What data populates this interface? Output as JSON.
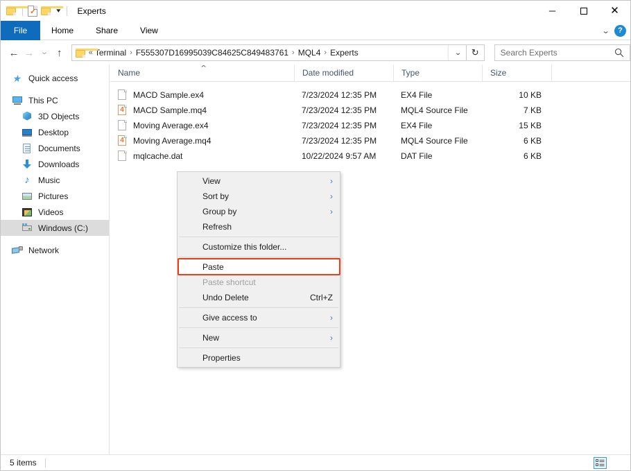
{
  "window": {
    "title": "Experts",
    "quick_access": {
      "folder_icon": "folder-icon",
      "properties_icon": "properties-document-icon",
      "new_folder_icon": "new-folder-icon",
      "customize_caret": "▾"
    },
    "controls": {
      "minimize": "─",
      "maximize": "maximize-icon",
      "close": "✕"
    }
  },
  "ribbon": {
    "tabs": [
      {
        "label": "File"
      },
      {
        "label": "Home"
      },
      {
        "label": "Share"
      },
      {
        "label": "View"
      }
    ],
    "collapse_caret": "⌄",
    "help_label": "?"
  },
  "address": {
    "back_icon": "←",
    "forward_icon": "→",
    "recent_icon": "⌄",
    "up_icon": "↑",
    "root_chevrons": "«",
    "crumbs": [
      "Terminal",
      "F555307D16995039C84625C849483761",
      "MQL4",
      "Experts"
    ],
    "crumb_separator": "›",
    "dropdown_caret": "⌄",
    "refresh_icon": "↻"
  },
  "search": {
    "placeholder": "Search Experts",
    "icon": "search-icon"
  },
  "sidebar": {
    "items": [
      {
        "label": "Quick access",
        "icon": "star-icon",
        "indent": false,
        "selected": false,
        "gap_after": true
      },
      {
        "label": "This PC",
        "icon": "computer-icon",
        "indent": false,
        "selected": false,
        "gap_after": false
      },
      {
        "label": "3D Objects",
        "icon": "3d-objects-icon",
        "indent": true,
        "selected": false,
        "gap_after": false
      },
      {
        "label": "Desktop",
        "icon": "desktop-icon",
        "indent": true,
        "selected": false,
        "gap_after": false
      },
      {
        "label": "Documents",
        "icon": "documents-icon",
        "indent": true,
        "selected": false,
        "gap_after": false
      },
      {
        "label": "Downloads",
        "icon": "downloads-icon",
        "indent": true,
        "selected": false,
        "gap_after": false
      },
      {
        "label": "Music",
        "icon": "music-icon",
        "indent": true,
        "selected": false,
        "gap_after": false
      },
      {
        "label": "Pictures",
        "icon": "pictures-icon",
        "indent": true,
        "selected": false,
        "gap_after": false
      },
      {
        "label": "Videos",
        "icon": "videos-icon",
        "indent": true,
        "selected": false,
        "gap_after": false
      },
      {
        "label": "Windows (C:)",
        "icon": "drive-icon",
        "indent": true,
        "selected": true,
        "gap_after": true
      },
      {
        "label": "Network",
        "icon": "network-icon",
        "indent": false,
        "selected": false,
        "gap_after": false
      }
    ]
  },
  "filelist": {
    "columns": [
      {
        "key": "name",
        "label": "Name"
      },
      {
        "key": "date",
        "label": "Date modified"
      },
      {
        "key": "type",
        "label": "Type"
      },
      {
        "key": "size",
        "label": "Size"
      }
    ],
    "sort_indicator": "⌃",
    "rows": [
      {
        "name": "MACD Sample.ex4",
        "date": "7/23/2024 12:35 PM",
        "type": "EX4 File",
        "size": "10 KB",
        "icon": "generic-file-icon"
      },
      {
        "name": "MACD Sample.mq4",
        "date": "7/23/2024 12:35 PM",
        "type": "MQL4 Source File",
        "size": "7 KB",
        "icon": "mq4-file-icon"
      },
      {
        "name": "Moving Average.ex4",
        "date": "7/23/2024 12:35 PM",
        "type": "EX4 File",
        "size": "15 KB",
        "icon": "generic-file-icon"
      },
      {
        "name": "Moving Average.mq4",
        "date": "7/23/2024 12:35 PM",
        "type": "MQL4 Source File",
        "size": "6 KB",
        "icon": "mq4-file-icon"
      },
      {
        "name": "mqlcache.dat",
        "date": "10/22/2024 9:57 AM",
        "type": "DAT File",
        "size": "6 KB",
        "icon": "generic-file-icon"
      }
    ]
  },
  "context_menu": {
    "items": [
      {
        "label": "View",
        "accel": "",
        "submenu": true,
        "disabled": false,
        "active": false,
        "sep_after": false
      },
      {
        "label": "Sort by",
        "accel": "",
        "submenu": true,
        "disabled": false,
        "active": false,
        "sep_after": false
      },
      {
        "label": "Group by",
        "accel": "",
        "submenu": true,
        "disabled": false,
        "active": false,
        "sep_after": false
      },
      {
        "label": "Refresh",
        "accel": "",
        "submenu": false,
        "disabled": false,
        "active": false,
        "sep_after": true
      },
      {
        "label": "Customize this folder...",
        "accel": "",
        "submenu": false,
        "disabled": false,
        "active": false,
        "sep_after": true
      },
      {
        "label": "Paste",
        "accel": "",
        "submenu": false,
        "disabled": false,
        "active": true,
        "sep_after": false
      },
      {
        "label": "Paste shortcut",
        "accel": "",
        "submenu": false,
        "disabled": true,
        "active": false,
        "sep_after": false
      },
      {
        "label": "Undo Delete",
        "accel": "Ctrl+Z",
        "submenu": false,
        "disabled": false,
        "active": false,
        "sep_after": true
      },
      {
        "label": "Give access to",
        "accel": "",
        "submenu": true,
        "disabled": false,
        "active": false,
        "sep_after": true
      },
      {
        "label": "New",
        "accel": "",
        "submenu": true,
        "disabled": false,
        "active": false,
        "sep_after": true
      },
      {
        "label": "Properties",
        "accel": "",
        "submenu": false,
        "disabled": false,
        "active": false,
        "sep_after": false
      }
    ],
    "submenu_arrow": "›",
    "highlight_color": "#ef3b16",
    "highlighted_item": "Paste"
  },
  "statusbar": {
    "item_count": "5 items",
    "view_details_icon": "details-view-icon",
    "view_largeicons_icon": "large-icons-view-icon"
  }
}
